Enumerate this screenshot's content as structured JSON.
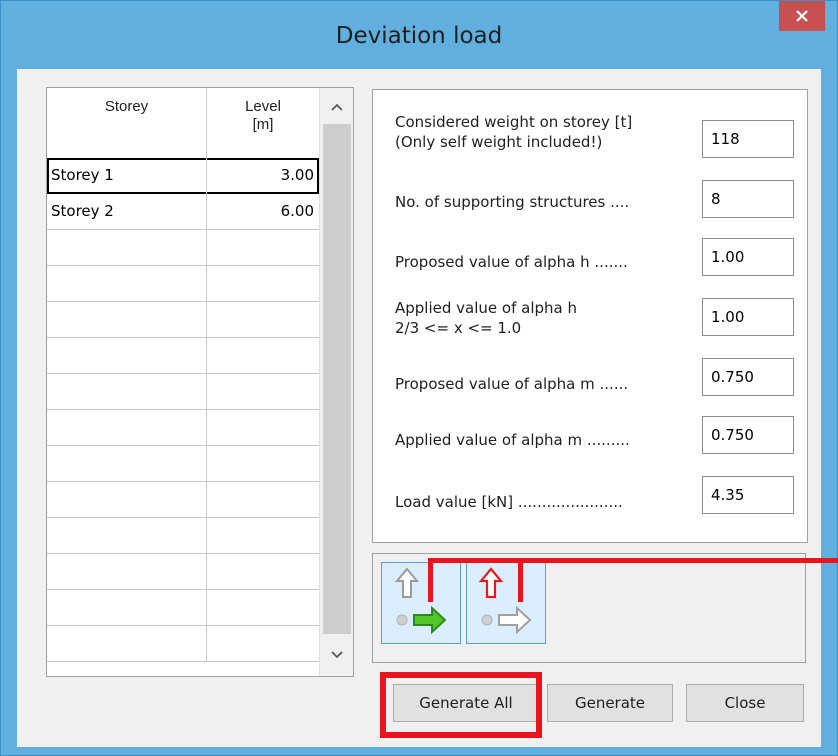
{
  "window": {
    "title": "Deviation load",
    "close_label": "×"
  },
  "grid": {
    "columns": [
      "Storey",
      "Level\n[m]"
    ],
    "col_storey": "Storey",
    "col_level_line1": "Level",
    "col_level_line2": "[m]",
    "rows": [
      {
        "name": "Storey 1",
        "level": "3.00",
        "selected": true
      },
      {
        "name": "Storey 2",
        "level": "6.00",
        "selected": false
      }
    ],
    "empty_rows": 12
  },
  "params": {
    "weight_label_1": "Considered weight on storey [t]",
    "weight_label_2": "(Only self weight included!)",
    "weight_value": "118",
    "supports_label": "No. of supporting structures ....",
    "supports_value": "8",
    "alpha_h_proposed_label": "Proposed value of alpha h .......",
    "alpha_h_proposed_value": "1.00",
    "alpha_h_applied_label_1": "Applied value of alpha h",
    "alpha_h_applied_label_2": "2/3 <= x <= 1.0",
    "alpha_h_applied_value": "1.00",
    "alpha_m_proposed_label": "Proposed value of alpha m ......",
    "alpha_m_proposed_value": "0.750",
    "alpha_m_applied_label": "Applied value of alpha m .........",
    "alpha_m_applied_value": "0.750",
    "load_label": "Load value [kN] ......................",
    "load_value": "4.35"
  },
  "toggles": [
    {
      "name": "horizontal-load-direction",
      "active_arrow_color": "#3aa81e"
    },
    {
      "name": "vertical-load-direction",
      "active_arrow_color": "#e01e1e"
    }
  ],
  "buttons": {
    "generate_all": "Generate All",
    "generate": "Generate",
    "close": "Close"
  },
  "colors": {
    "title_bar": "#61afde",
    "close_button": "#c75050",
    "annotation": "#e8141e"
  }
}
